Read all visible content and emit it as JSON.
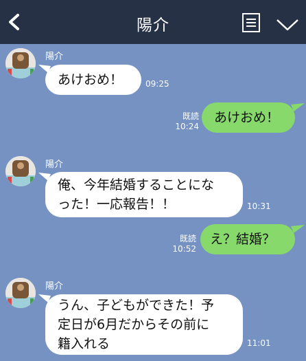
{
  "header": {
    "title": "陽介",
    "back_icon": "chevron-left-icon",
    "notes_icon": "notes-icon",
    "menu_icon": "chevron-down-icon",
    "background": "#263146"
  },
  "chat": {
    "background": "#7592c2",
    "incoming_color": "#ffffff",
    "outgoing_color": "#86d96a",
    "messages": [
      {
        "direction": "in",
        "sender": "陽介",
        "text": "あけおめ！",
        "time": "09:25"
      },
      {
        "direction": "out",
        "read": "既読",
        "text": "あけおめ！",
        "time": "10:24"
      },
      {
        "direction": "in",
        "sender": "陽介",
        "text": "俺、今年結婚することにな\nった！一応報告！！",
        "time": "10:31"
      },
      {
        "direction": "out",
        "read": "既読",
        "text": "え？結婚？",
        "time": "10:52"
      },
      {
        "direction": "in",
        "sender": "陽介",
        "text": "うん、子どもができた！予\n定日が6月だからその前に\n籍入れる",
        "time": "11:01"
      }
    ]
  }
}
